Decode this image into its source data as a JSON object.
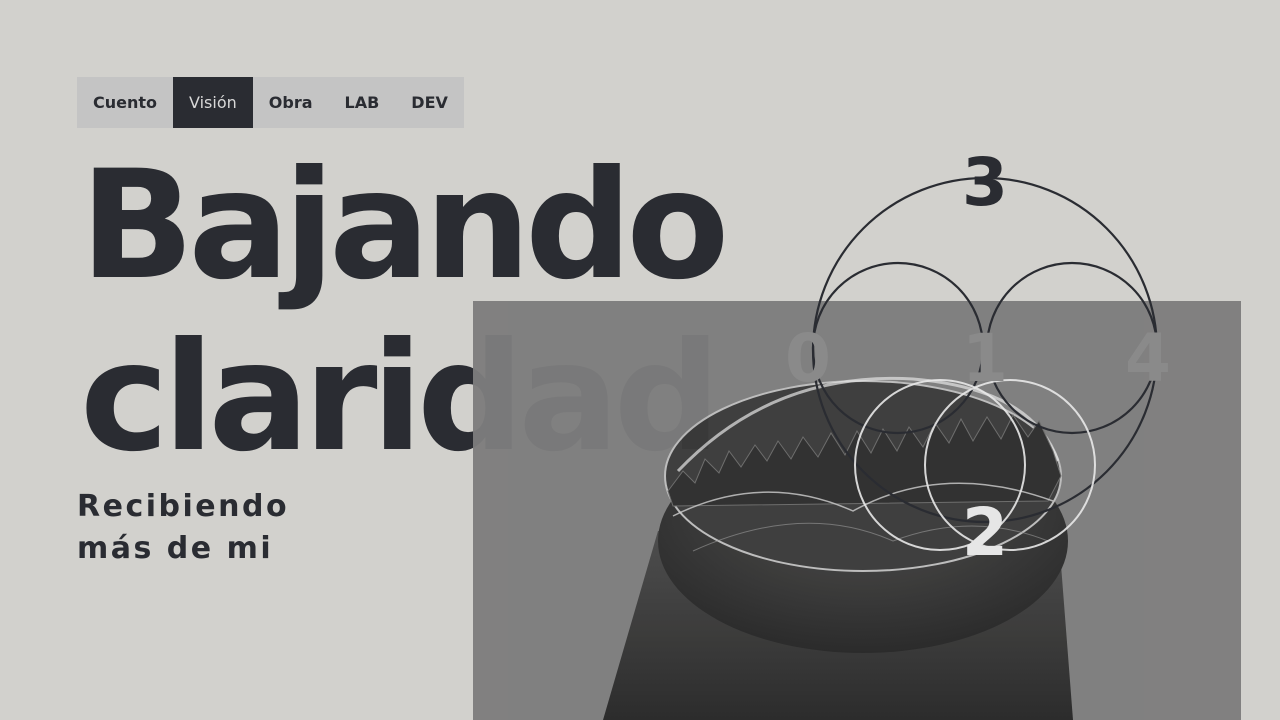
{
  "nav": {
    "items": [
      {
        "label": "Cuento",
        "active": false
      },
      {
        "label": "Visión",
        "active": true
      },
      {
        "label": "Obra",
        "active": false
      },
      {
        "label": "LAB",
        "active": false
      },
      {
        "label": "DEV",
        "active": false
      }
    ]
  },
  "hero": {
    "title_line1": "Bajando",
    "title_line2": "claridad",
    "subtitle_line1": "Recibiendo",
    "subtitle_line2": "más de mi"
  },
  "diagram": {
    "numbers": [
      "3",
      "0",
      "1",
      "4",
      "2"
    ]
  },
  "colors": {
    "background": "#d2d1cd",
    "ink": "#2a2c32",
    "nav_bg": "#c4c4c4",
    "panel_bg": "#7d7d7d"
  }
}
